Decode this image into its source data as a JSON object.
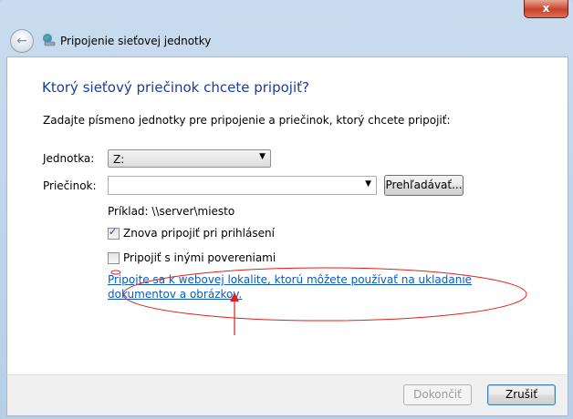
{
  "window": {
    "faded_title": "",
    "close_label": "x",
    "wizard_title": "Pripojenie sieťovej jednotky"
  },
  "content": {
    "heading": "Ktorý sieťový priečinok chcete pripojiť?",
    "instruction": "Zadajte písmeno jednotky pre pripojenie a priečinok, ktorý chcete pripojiť:",
    "drive_label": "Jednotka:",
    "drive_value": "Z:",
    "folder_label": "Priečinok:",
    "folder_value": "",
    "browse_label": "Prehľadávať...",
    "example": "Príklad: \\\\server\\miesto",
    "reconnect_label": "Znova pripojiť pri prihlásení",
    "reconnect_checked": true,
    "credentials_label": "Pripojiť s inými povereniami",
    "credentials_checked": false,
    "link_text": "Pripojte sa k webovej lokalite, ktorú môžete používať na ukladanie dokumentov a obrázkov."
  },
  "footer": {
    "finish_label": "Dokončiť",
    "cancel_label": "Zrušiť"
  },
  "colors": {
    "heading": "#1a3e9b",
    "link": "#0a5bc4",
    "annotation": "#e0201a"
  },
  "icons": [
    "back-arrow-icon",
    "network-drive-icon",
    "close-icon",
    "chevron-down-icon",
    "checkmark-icon"
  ]
}
